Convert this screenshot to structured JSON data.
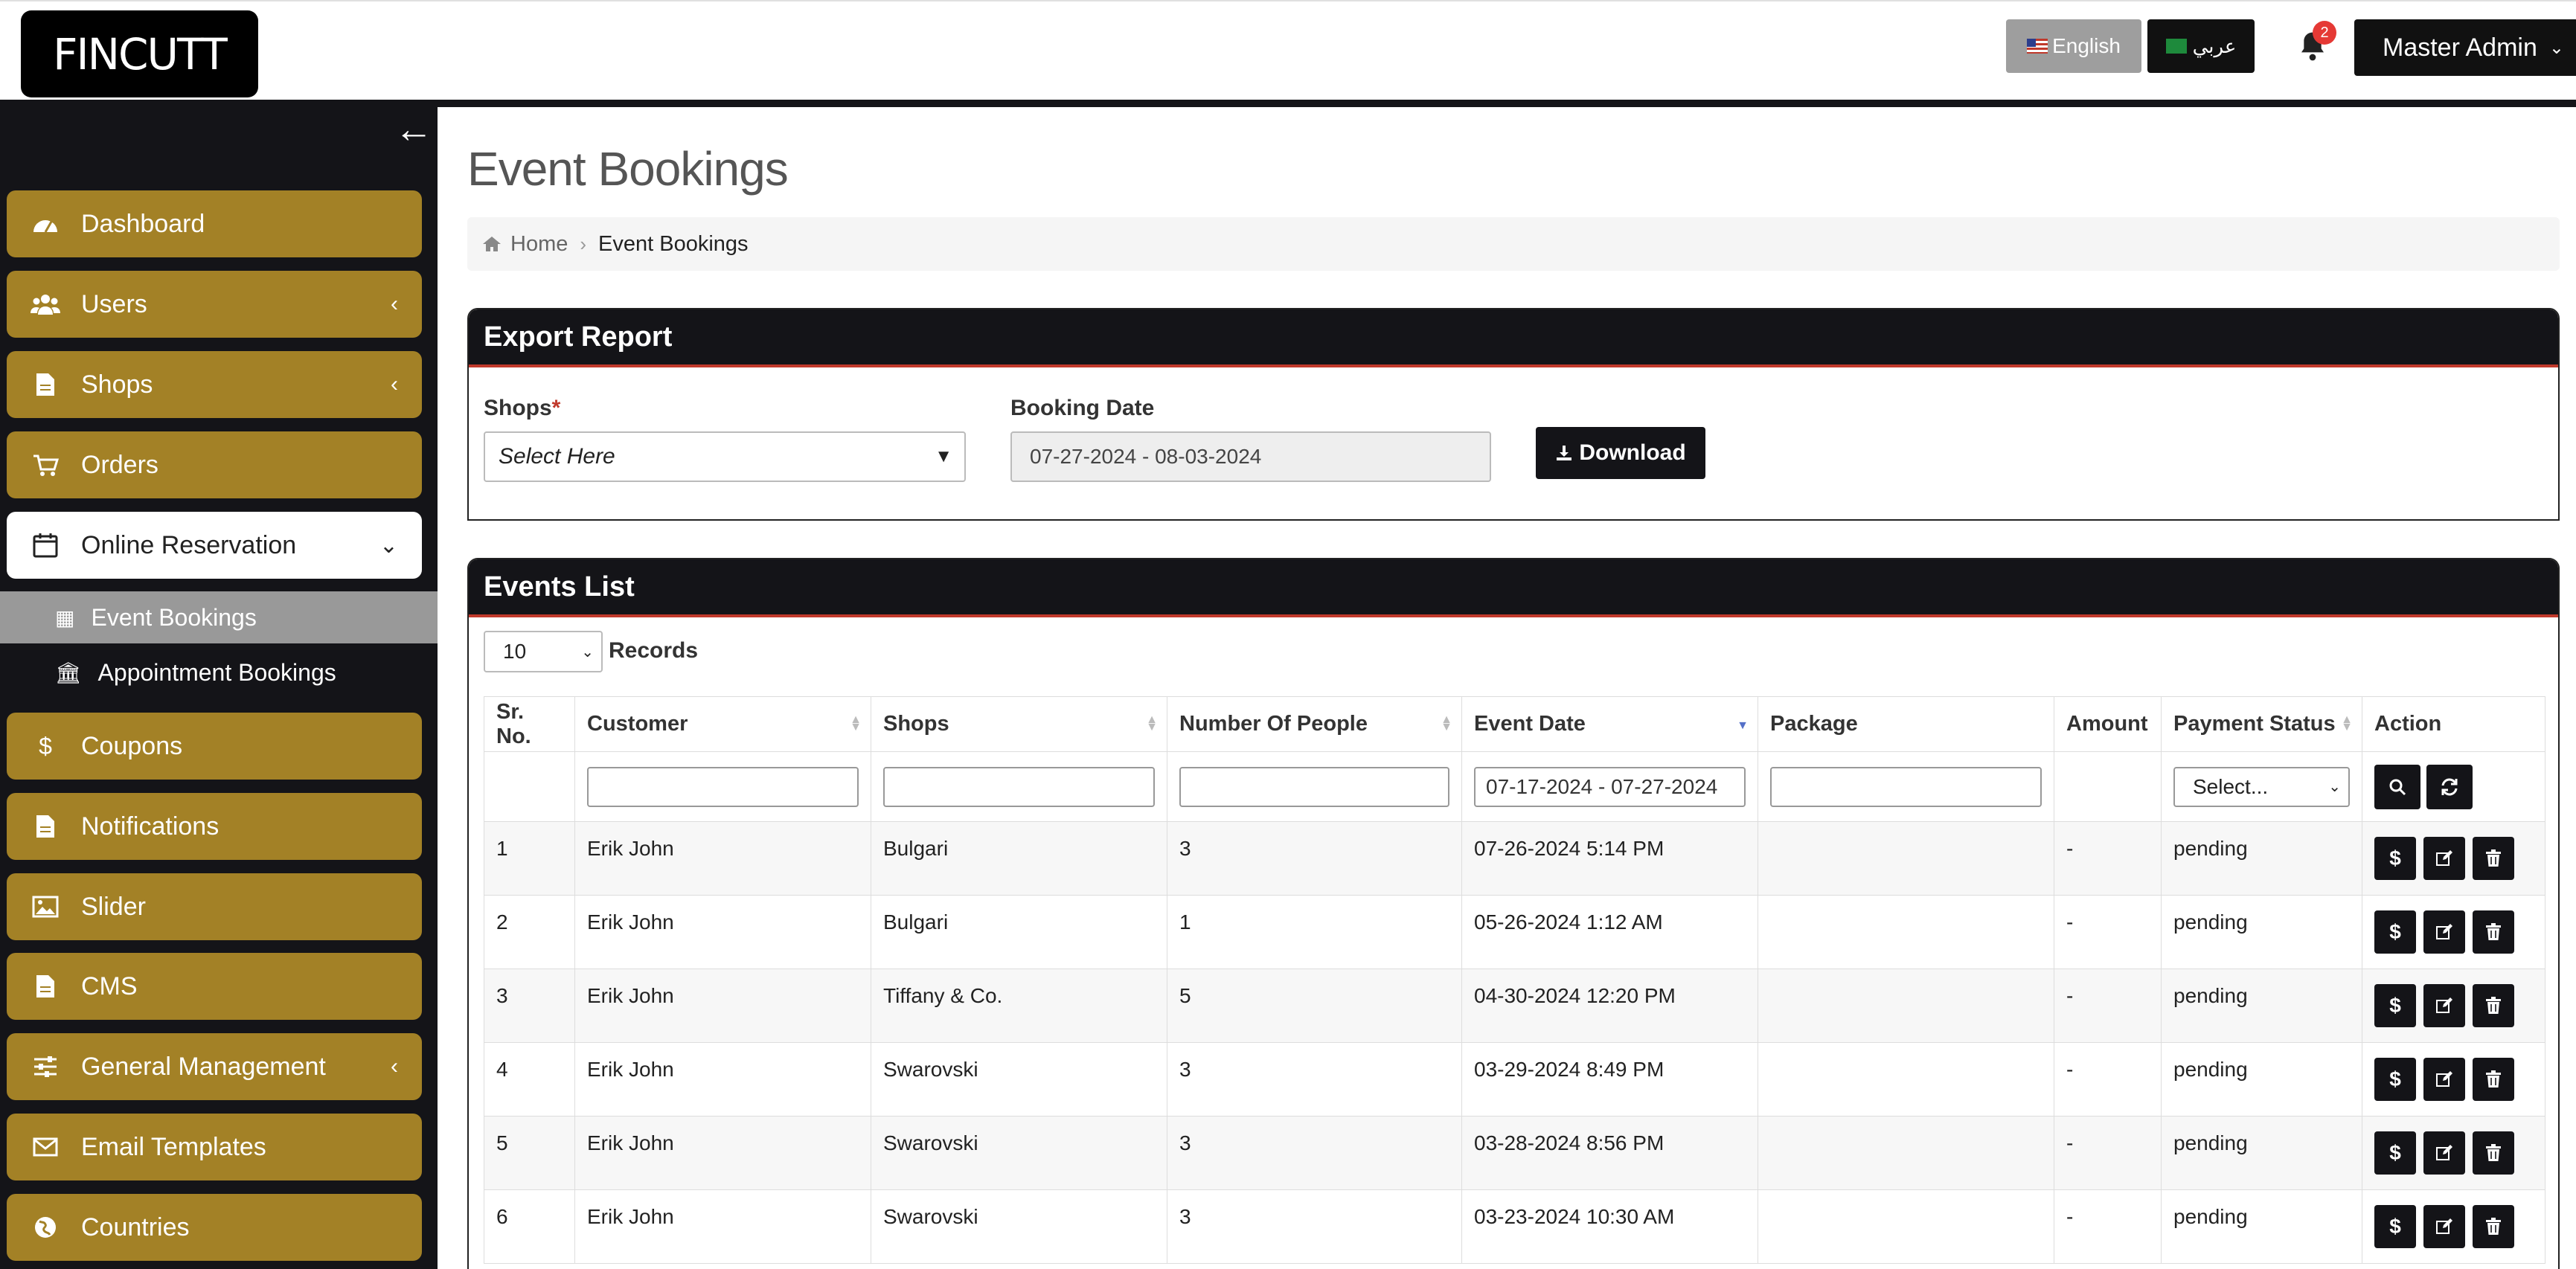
{
  "header": {
    "logo_text": "FINCUTT",
    "lang_english": "English",
    "lang_arabic": "عربي",
    "notification_count": "2",
    "admin_label": "Master Admin"
  },
  "sidebar": {
    "items": [
      {
        "label": "Dashboard",
        "icon": "dashboard-icon"
      },
      {
        "label": "Users",
        "icon": "users-icon"
      },
      {
        "label": "Shops",
        "icon": "document-icon"
      },
      {
        "label": "Orders",
        "icon": "cart-icon"
      },
      {
        "label": "Online Reservation",
        "icon": "calendar-icon"
      },
      {
        "label": "Coupons",
        "icon": "dollar-icon"
      },
      {
        "label": "Notifications",
        "icon": "document-icon"
      },
      {
        "label": "Slider",
        "icon": "image-icon"
      },
      {
        "label": "CMS",
        "icon": "document-icon"
      },
      {
        "label": "General Management",
        "icon": "sliders-icon"
      },
      {
        "label": "Email Templates",
        "icon": "envelope-icon"
      },
      {
        "label": "Countries",
        "icon": "globe-icon"
      }
    ],
    "subitems": [
      {
        "label": "Event Bookings",
        "icon": "calendar-icon"
      },
      {
        "label": "Appointment Bookings",
        "icon": "bank-icon"
      }
    ]
  },
  "page": {
    "title": "Event Bookings",
    "breadcrumb_home": "Home",
    "breadcrumb_current": "Event Bookings"
  },
  "export": {
    "title": "Export Report",
    "shops_label": "Shops",
    "shops_required": "*",
    "shops_placeholder": "Select Here",
    "booking_date_label": "Booking Date",
    "booking_date_value": "07-27-2024 - 08-03-2024",
    "download_label": "Download"
  },
  "events": {
    "title": "Events List",
    "records_value": "10",
    "records_label": "Records",
    "columns": [
      "Sr. No.",
      "Customer",
      "Shops",
      "Number Of People",
      "Event Date",
      "Package",
      "Amount",
      "Payment Status",
      "Action"
    ],
    "filters": {
      "event_date": "07-17-2024 - 07-27-2024",
      "payment_status": "Select..."
    },
    "rows": [
      {
        "sr": "1",
        "customer": "Erik John",
        "shop": "Bulgari",
        "people": "3",
        "date": "07-26-2024 5:14 PM",
        "package": "",
        "amount": "-",
        "status": "pending"
      },
      {
        "sr": "2",
        "customer": "Erik John",
        "shop": "Bulgari",
        "people": "1",
        "date": "05-26-2024 1:12 AM",
        "package": "",
        "amount": "-",
        "status": "pending"
      },
      {
        "sr": "3",
        "customer": "Erik John",
        "shop": "Tiffany & Co.",
        "people": "5",
        "date": "04-30-2024 12:20 PM",
        "package": "",
        "amount": "-",
        "status": "pending"
      },
      {
        "sr": "4",
        "customer": "Erik John",
        "shop": "Swarovski",
        "people": "3",
        "date": "03-29-2024 8:49 PM",
        "package": "",
        "amount": "-",
        "status": "pending"
      },
      {
        "sr": "5",
        "customer": "Erik John",
        "shop": "Swarovski",
        "people": "3",
        "date": "03-28-2024 8:56 PM",
        "package": "",
        "amount": "-",
        "status": "pending"
      },
      {
        "sr": "6",
        "customer": "Erik John",
        "shop": "Swarovski",
        "people": "3",
        "date": "03-23-2024 10:30 AM",
        "package": "",
        "amount": "-",
        "status": "pending"
      }
    ]
  }
}
